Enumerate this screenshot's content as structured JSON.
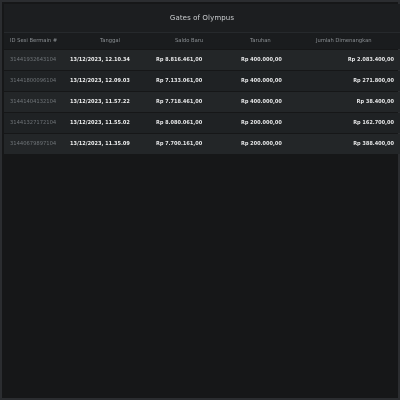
{
  "header": {
    "title": "Gates of Olympus"
  },
  "table": {
    "columns": [
      "ID Sesi Bermain #",
      "Tanggal",
      "Saldo Baru",
      "Taruhan",
      "Jumlah Dimenangkan"
    ],
    "rows": [
      {
        "id": "31441932643104",
        "date": "13/12/2023, 12.10.34",
        "saldo": "Rp 8.816.461,00",
        "bet": "Rp 400.000,00",
        "win": "Rp 2.083.400,00"
      },
      {
        "id": "31441800096104",
        "date": "13/12/2023, 12.09.03",
        "saldo": "Rp 7.133.061,00",
        "bet": "Rp 400.000,00",
        "win": "Rp 271.800,00"
      },
      {
        "id": "31441404132104",
        "date": "13/12/2023, 11.57.22",
        "saldo": "Rp 7.718.461,00",
        "bet": "Rp 400.000,00",
        "win": "Rp 38.400,00"
      },
      {
        "id": "31441327172104",
        "date": "13/12/2023, 11.55.02",
        "saldo": "Rp 8.080.061,00",
        "bet": "Rp 200.000,00",
        "win": "Rp 162.700,00"
      },
      {
        "id": "31440679897104",
        "date": "13/12/2023, 11.35.09",
        "saldo": "Rp 7.700.161,00",
        "bet": "Rp 200.000,00",
        "win": "Rp 388.400,00"
      }
    ]
  }
}
